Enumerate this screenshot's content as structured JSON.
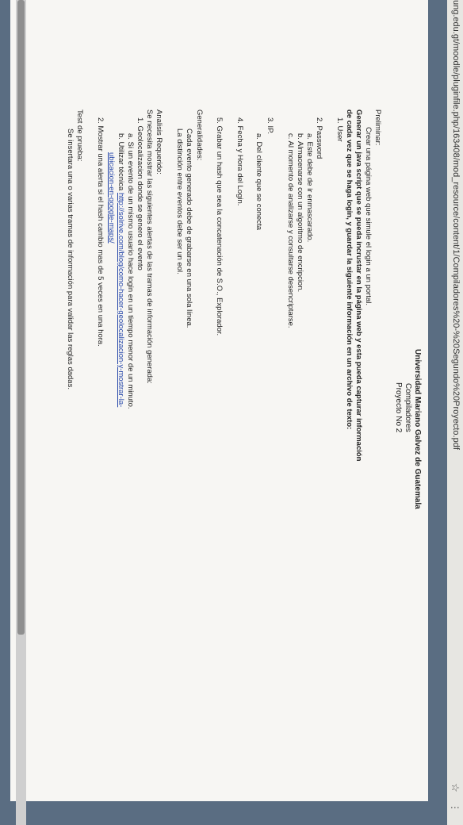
{
  "url": "ung.edu.gt/moodle/pluginfile.php/163408/mod_resource/content/1/Compiladores%20-%20Segundo%20Proyecto.pdf",
  "icons": {
    "bookmark": "star-icon",
    "menu": "menu-icon"
  },
  "doc": {
    "header": {
      "university": "Universidad Mariano Galvez de Guatemala",
      "course": "Compiladores",
      "project": "Proyecto No 2"
    },
    "preliminar": {
      "heading": "Preliminar:",
      "intro": "Crear una página web que simule el login a un portal.",
      "bold_line1": "Generar un java script que se pueda incrustar en la página web y esta pueda capturar información",
      "bold_line2": "de cada vez que se haga login, y guardar la siguiente información en un archivo de texto:",
      "item1": "1.   User",
      "item2": "2.   Password",
      "item2a": "a.   Este debe de ir enmascarado.",
      "item2b": "b.   Almacenarse con un algoritmo de encripcion.",
      "item2c": "c.   Al momento de analizarse y consultarse desencriptarse.",
      "item3": "3.   IP.",
      "item3a": "a.   Del cliente que se conecta",
      "item4": "4.   Fecha y Hora del Login.",
      "item5": "5.   Grabar un hash que sea la concatenación de S.O., Explorador."
    },
    "generalidades": {
      "heading": "Generalidades:",
      "line1": "Cada evento generado debe de grabarse en una sola línea.",
      "line2": "La distinción entre eventos debe ser un eol."
    },
    "analisis": {
      "heading": "Analisis Requerido:",
      "intro": "Se necesita mostrar las siguientes alertas de las tramas de información generada:",
      "item1": "1.   Geolocalizacion donde se genero el evento",
      "item1a": "a.   Si un evento de un mismo usuario hace login en un tiempo menor de un minuto.",
      "item1b_prefix": "b.   Utilizar técnica ",
      "item1b_link1": "http://solrive.com/blog/como-hacer-geolocalizacion-y-mostrar-la-",
      "item1b_link2": "ubicacion-en-google-maps/",
      "item2": "2.   Mostrar una alerta si el hash cambio mas de 5 veces en una hora."
    },
    "test": {
      "heading": "Test de prueba:",
      "line": "Se insertara una o varias tramas de información para validar las reglas dadas."
    }
  }
}
